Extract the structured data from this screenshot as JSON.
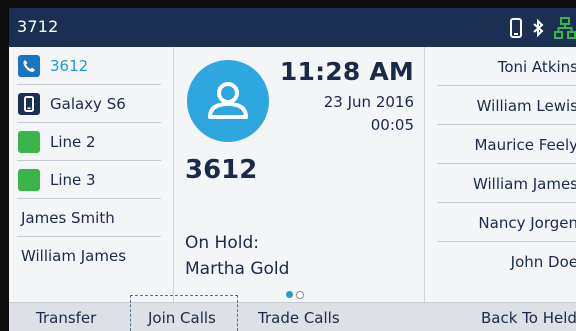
{
  "status_bar": {
    "extension": "3712",
    "icons": [
      "phone-handset-icon",
      "bluetooth-icon",
      "network-icon"
    ]
  },
  "line_keys": [
    {
      "label": "3612",
      "icon": "phone-icon",
      "color": "#1a74c4",
      "active": true
    },
    {
      "label": "Galaxy S6",
      "icon": "mobile-phone-icon",
      "color": "#1a2f52",
      "active": false
    },
    {
      "label": "Line 2",
      "icon": "green-square",
      "color": "#3ab54a",
      "active": false
    },
    {
      "label": "Line 3",
      "icon": "green-square",
      "color": "#3ab54a",
      "active": false
    }
  ],
  "left_contacts": [
    {
      "label": "James Smith"
    },
    {
      "label": "William James"
    }
  ],
  "call_panel": {
    "avatar_icon": "person-icon",
    "time": "11:28 AM",
    "date": "23 Jun 2016",
    "duration": "00:05",
    "number": "3612",
    "hold_label": "On Hold:",
    "hold_name": "Martha Gold",
    "page_indicator": {
      "current": 1,
      "total": 2
    }
  },
  "right_contacts": [
    {
      "label": "Toni Atkins"
    },
    {
      "label": "William Lewis"
    },
    {
      "label": "Maurice Feely"
    },
    {
      "label": "William James"
    },
    {
      "label": "Nancy Jorgen"
    },
    {
      "label": "John Doe"
    }
  ],
  "softkeys": [
    {
      "label": "Transfer"
    },
    {
      "label": "Join Calls",
      "focused": true
    },
    {
      "label": "Trade Calls"
    },
    {
      "label": "Back To Held"
    }
  ],
  "colors": {
    "status_bar": "#1a2f52",
    "accent": "#1f9bd7",
    "avatar": "#2ea6df",
    "network_green": "#3ab54a"
  }
}
